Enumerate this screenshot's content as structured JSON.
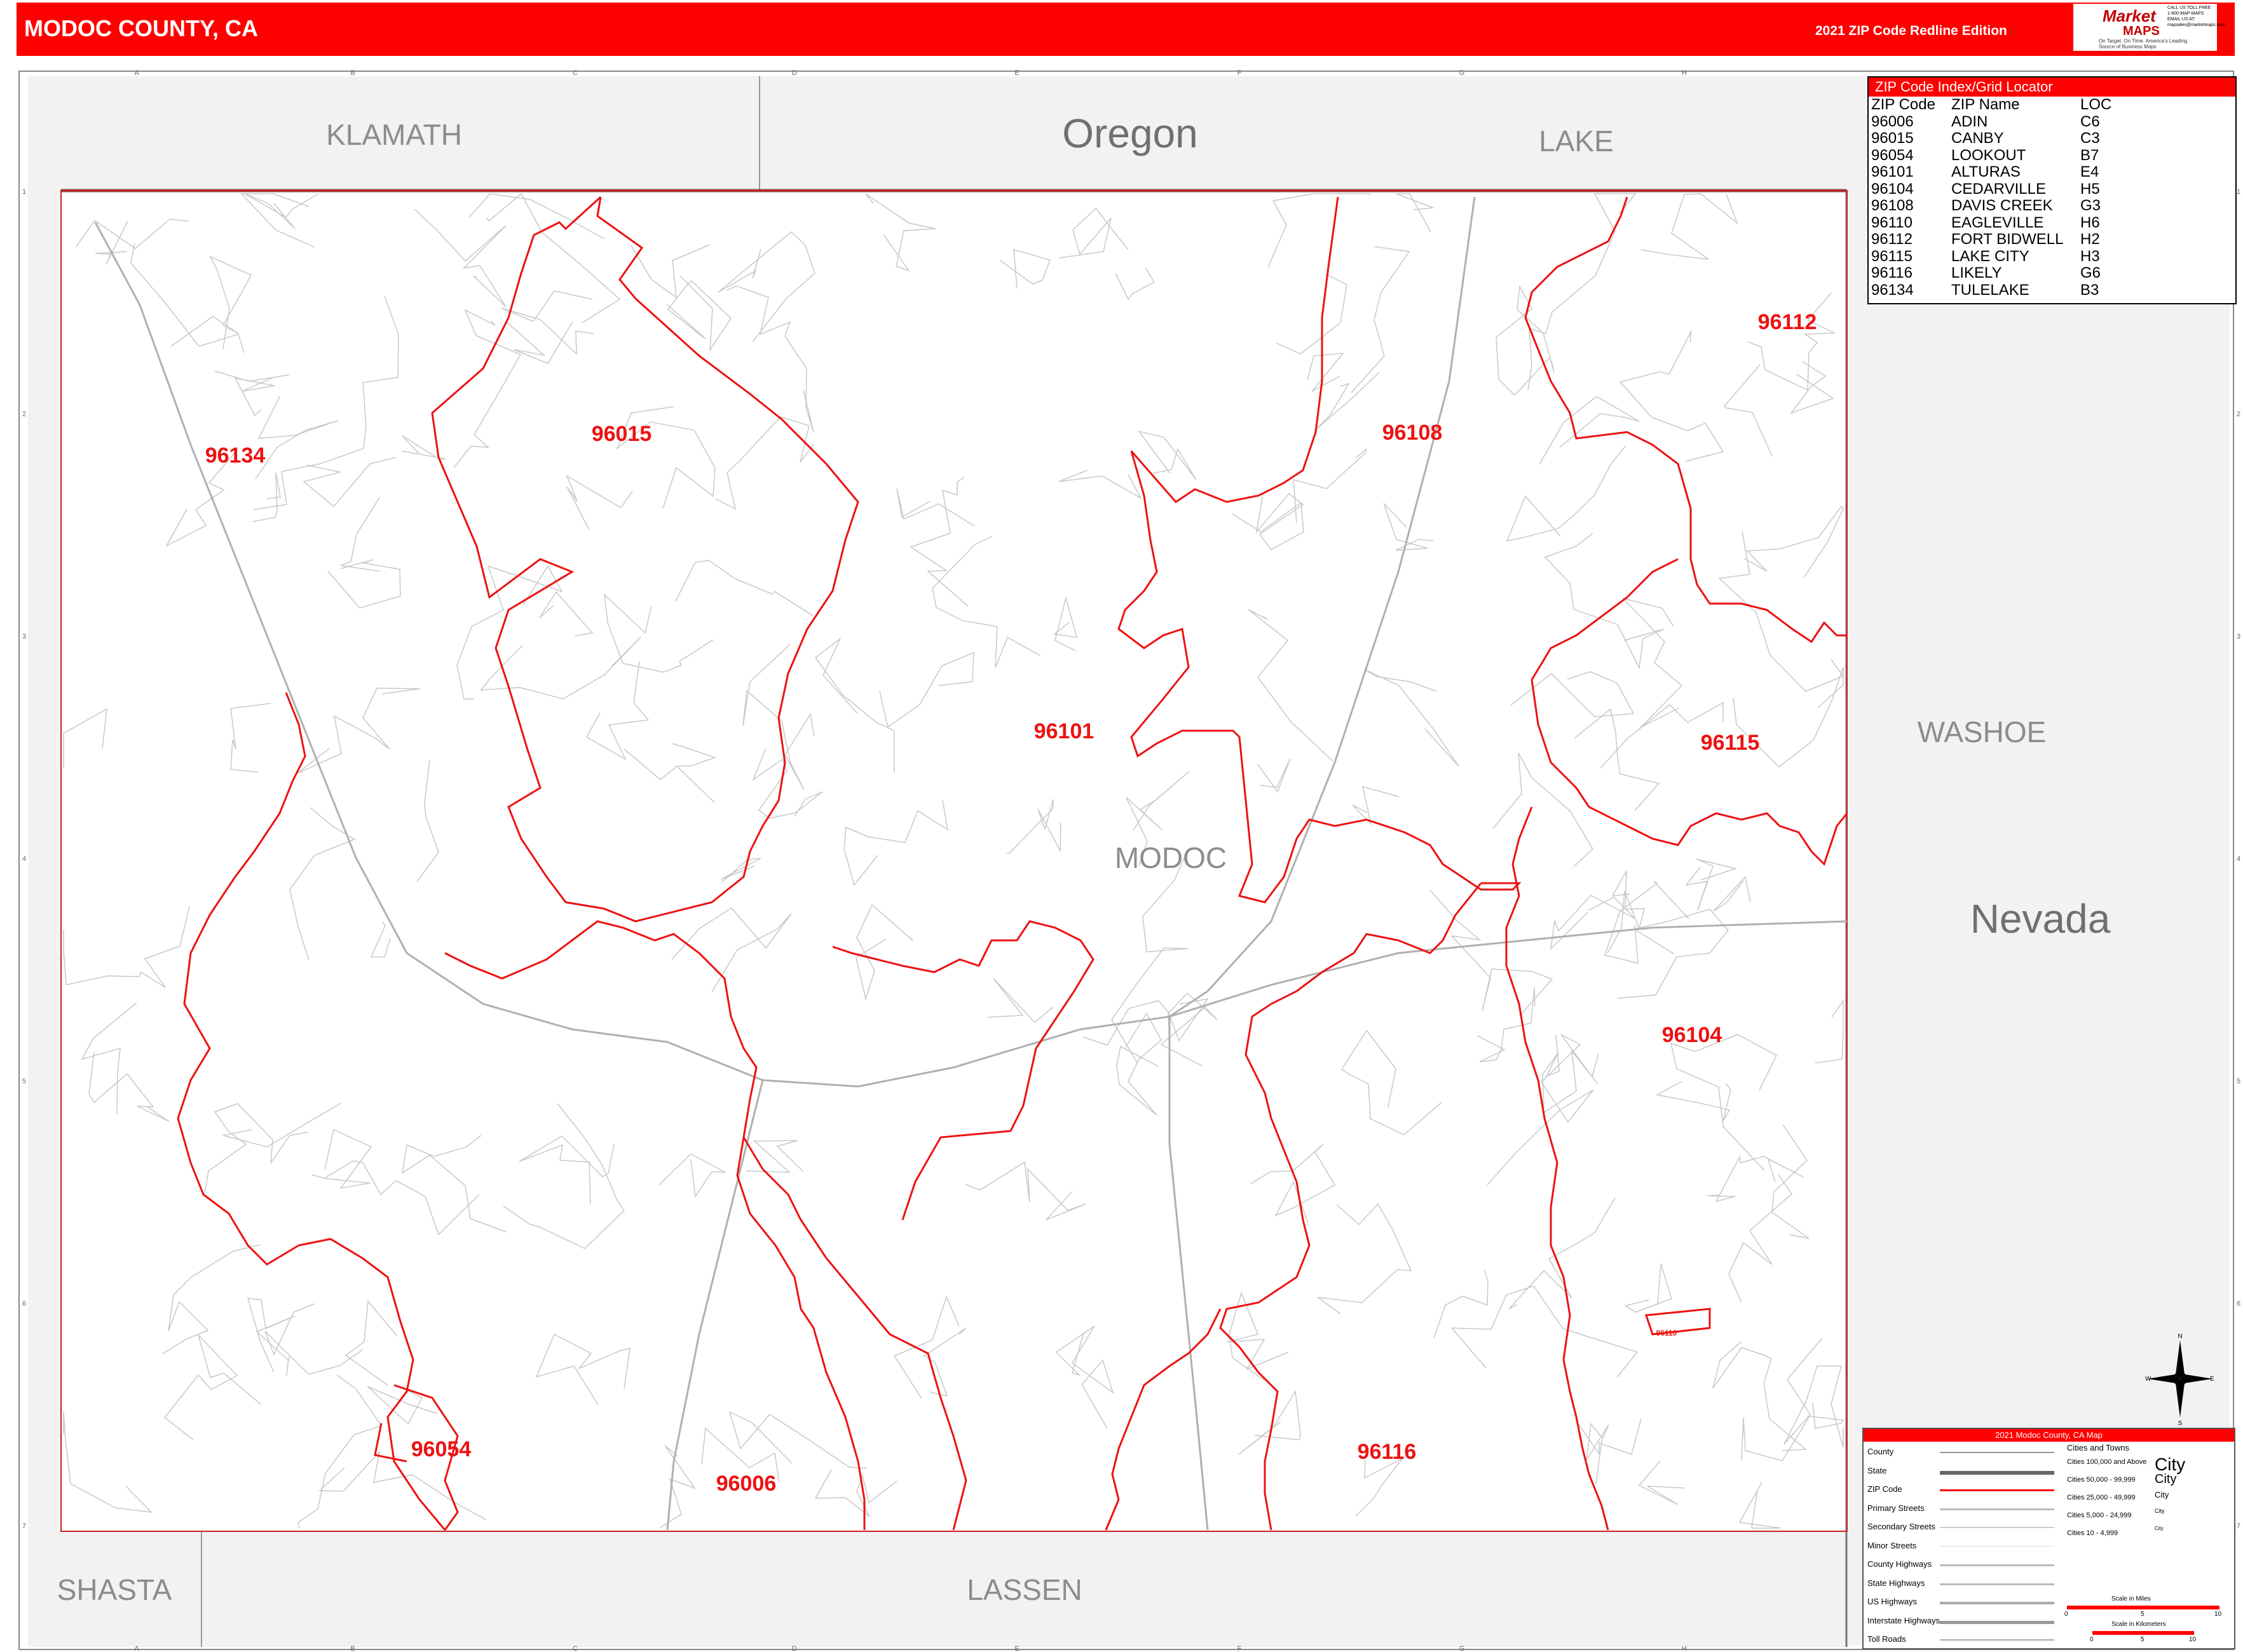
{
  "header": {
    "title": "MODOC COUNTY, CA",
    "edition": "2021 ZIP Code Redline Edition"
  },
  "logo": {
    "text_top": "Market",
    "text_main": "MAPS",
    "slogan": "On Target. On Time. America's Leading Source of Business Maps",
    "contact": "CALL US TOLL FREE 1-800-MAP-MAPS EMAIL US AT: mapsales@marketmaps.com"
  },
  "grid": {
    "columns": [
      "A",
      "B",
      "C",
      "D",
      "E",
      "F",
      "G",
      "H"
    ],
    "rows": [
      "1",
      "2",
      "3",
      "4",
      "5",
      "6",
      "7"
    ]
  },
  "regions": {
    "klamath": "KLAMATH",
    "oregon": "Oregon",
    "lake": "LAKE",
    "washoe": "WASHOE",
    "nevada": "Nevada",
    "modoc": "MODOC",
    "shasta": "SHASTA",
    "lassen": "LASSEN"
  },
  "zip_labels": [
    "96134",
    "96015",
    "96108",
    "96112",
    "96101",
    "96115",
    "96104",
    "96054",
    "96006",
    "96116",
    "96110"
  ],
  "zip_index": {
    "title": "ZIP Code Index/Grid Locator",
    "columns": [
      "ZIP Code",
      "ZIP Name",
      "LOC"
    ],
    "rows": [
      [
        "96006",
        "ADIN",
        "C6"
      ],
      [
        "96015",
        "CANBY",
        "C3"
      ],
      [
        "96054",
        "LOOKOUT",
        "B7"
      ],
      [
        "96101",
        "ALTURAS",
        "E4"
      ],
      [
        "96104",
        "CEDARVILLE",
        "H5"
      ],
      [
        "96108",
        "DAVIS CREEK",
        "G3"
      ],
      [
        "96110",
        "EAGLEVILLE",
        "H6"
      ],
      [
        "96112",
        "FORT BIDWELL",
        "H2"
      ],
      [
        "96115",
        "LAKE CITY",
        "H3"
      ],
      [
        "96116",
        "LIKELY",
        "G6"
      ],
      [
        "96134",
        "TULELAKE",
        "B3"
      ]
    ]
  },
  "legend": {
    "title": "2021 Modoc County, CA Map",
    "items": [
      "County",
      "State",
      "ZIP Code",
      "Primary Streets",
      "Secondary Streets",
      "Minor Streets",
      "County Highways",
      "State Highways",
      "US Highways",
      "Interstate Highways",
      "Toll Roads"
    ],
    "cities_title": "Cities and Towns",
    "cities": [
      "Cities 100,000 and Above",
      "Cities 50,000 - 99,999",
      "Cities 25,000 - 49,999",
      "Cities 5,000 - 24,999",
      "Cities 10 - 4,999"
    ],
    "city_sample": "City",
    "scale_miles": "Scale in Miles",
    "scale_km": "Scale in Kilometers",
    "scale_ticks_miles": [
      "0",
      "5",
      "10"
    ],
    "scale_ticks_km": [
      "0",
      "5",
      "10"
    ]
  },
  "compass": {
    "n": "N",
    "s": "S",
    "e": "E",
    "w": "W"
  },
  "colors": {
    "accent": "#ff0000",
    "neutral": "#f2f2f2",
    "label_gray": "#8c8c8c",
    "road": "#c8c8c8"
  }
}
